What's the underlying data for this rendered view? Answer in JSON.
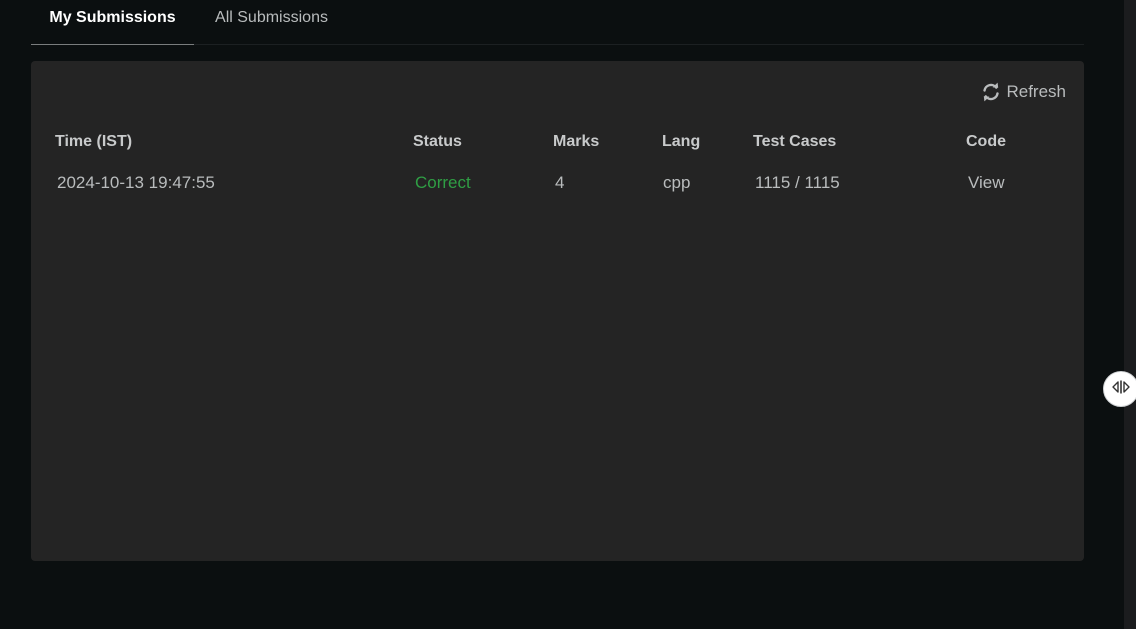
{
  "tabs": {
    "my_submissions": "My Submissions",
    "all_submissions": "All Submissions"
  },
  "panel": {
    "refresh_label": "Refresh",
    "refresh_icon": "refresh-icon",
    "columns": {
      "time": "Time (IST)",
      "status": "Status",
      "marks": "Marks",
      "lang": "Lang",
      "test_cases": "Test Cases",
      "code": "Code"
    },
    "rows": [
      {
        "time": "2024-10-13 19:47:55",
        "status": "Correct",
        "marks": "4",
        "lang": "cpp",
        "test_cases": "1115 / 1115",
        "code": "View"
      }
    ]
  },
  "colors": {
    "background": "#0b0f10",
    "panel": "#242424",
    "status_correct": "#2f9e44"
  },
  "resize_handle_icon": "split-resize-icon"
}
